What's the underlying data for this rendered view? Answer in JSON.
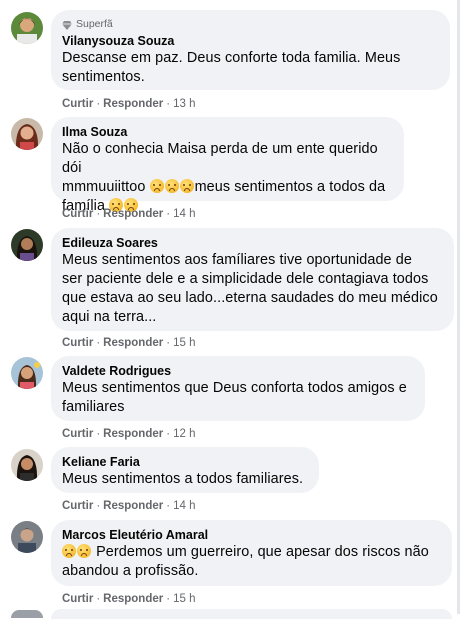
{
  "comments": [
    {
      "badge": "Superfã",
      "name": "Vilanysouza Souza",
      "text_lines": [
        "Descanse em paz. Deus conforte toda familia. Meus",
        "sentimentos."
      ],
      "like": "Curtir",
      "reply": "Responder",
      "time": "13 h"
    },
    {
      "name": "Ilma Souza",
      "text_lines": [
        "Não o conhecia Maisa perda de um ente querido dói",
        "mmmuuiittoo",
        "meus sentimentos a todos da",
        "família"
      ],
      "like": "Curtir",
      "reply": "Responder",
      "time": "14 h"
    },
    {
      "name": "Edileuza Soares",
      "text_lines": [
        "Meus sentimentos aos famíliares tive oportunidade de",
        "ser paciente dele e a simplicidade dele contagiava todos",
        "que estava ao seu lado...eterna saudades do meu médico",
        "aqui na terra..."
      ],
      "like": "Curtir",
      "reply": "Responder",
      "time": "15 h"
    },
    {
      "name": "Valdete Rodrigues",
      "text_lines": [
        "Meus sentimentos que Deus conforta todos amigos e",
        "familiares"
      ],
      "like": "Curtir",
      "reply": "Responder",
      "time": "12 h"
    },
    {
      "name": "Keliane Faria",
      "text_lines": [
        "Meus sentimentos a todos familiares."
      ],
      "like": "Curtir",
      "reply": "Responder",
      "time": "14 h"
    },
    {
      "name": "Marcos Eleutério Amaral",
      "text_lines": [
        "Perdemos um guerreiro, que apesar dos riscos não",
        "abandou a profissão."
      ],
      "like": "Curtir",
      "reply": "Responder",
      "time": "15 h"
    }
  ],
  "colors": {
    "bubble": "#f0f2f5",
    "meta": "#65676b",
    "text": "#050505"
  },
  "icons": {
    "badge": "diamond-icon",
    "emoji": "sad-face-emoji-icon"
  }
}
